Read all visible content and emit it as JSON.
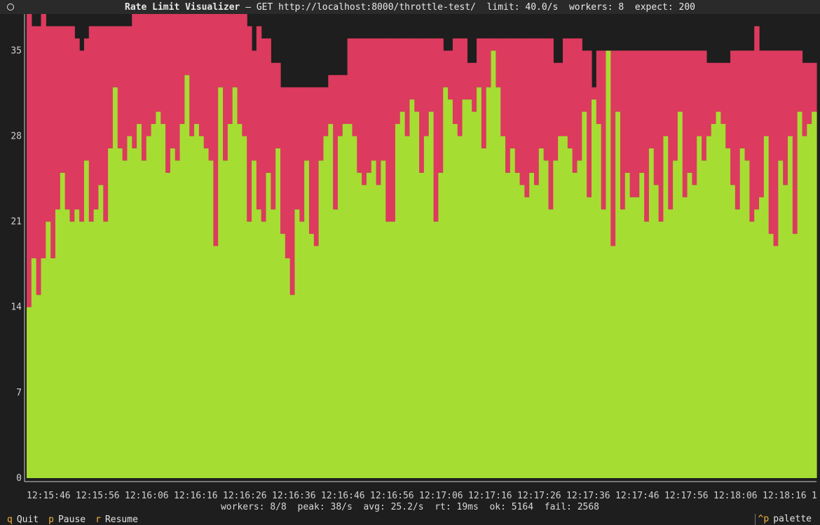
{
  "window": {
    "title": "Rate Limit Visualizer",
    "subtitle": " — GET http://localhost:8000/throttle-test/  limit: 40.0/s  workers: 8  expect: 200"
  },
  "footer": {
    "stats": "workers: 8/8  peak: 38/s  avg: 25.2/s  rt: 19ms  ok: 5164  fail: 2568"
  },
  "keys": [
    {
      "key": "q",
      "label": "Quit"
    },
    {
      "key": "p",
      "label": "Pause"
    },
    {
      "key": "r",
      "label": "Resume"
    }
  ],
  "palette": {
    "key": "^p",
    "label": "palette"
  },
  "colors": {
    "ok": "#a6dd33",
    "fail": "#dc3a5e",
    "empty": "#1e1e1e",
    "axis": "#cccccc"
  },
  "chart_data": {
    "type": "bar",
    "stacked": true,
    "ylim": [
      0,
      38
    ],
    "y_ticks": [
      0,
      7,
      14,
      21,
      28,
      35
    ],
    "x_tick_labels": [
      "12:15:46",
      "12:15:56",
      "12:16:06",
      "12:16:16",
      "12:16:26",
      "12:16:36",
      "12:16:46",
      "12:16:56",
      "12:17:06",
      "12:17:16",
      "12:17:26",
      "12:17:36",
      "12:17:46",
      "12:17:56",
      "12:18:06",
      "12:18:16",
      "1"
    ],
    "series": [
      {
        "values": [
          14,
          18,
          15,
          18,
          21,
          18,
          22,
          25,
          22,
          21,
          22,
          21,
          26,
          21,
          22,
          24,
          21,
          27,
          32,
          27,
          26,
          28,
          27,
          29,
          26,
          28,
          29,
          30,
          29,
          25,
          27,
          26,
          29,
          33,
          28,
          29,
          28,
          27,
          26,
          19,
          32,
          26,
          29,
          32,
          29,
          28,
          21,
          26,
          22,
          21,
          25,
          22,
          27,
          20,
          18,
          15,
          22,
          21,
          26,
          20,
          19,
          26,
          28,
          29,
          22,
          28,
          29,
          29,
          28,
          25,
          24,
          25,
          26,
          24,
          26,
          21,
          21,
          29,
          30,
          28,
          31,
          30,
          25,
          28,
          30,
          21,
          25,
          32,
          31,
          29,
          28,
          31,
          31,
          30,
          32,
          27,
          32,
          35,
          32,
          28,
          25,
          27,
          25,
          24,
          23,
          25,
          24,
          27,
          26,
          22,
          26,
          28,
          28,
          27,
          25,
          26,
          30,
          23,
          31,
          29,
          22,
          35,
          19,
          30,
          22,
          25,
          23,
          23,
          25,
          21,
          27,
          24,
          21,
          28,
          22,
          26,
          30,
          23,
          25,
          24,
          28,
          26,
          28,
          29,
          30,
          29,
          27,
          24,
          22,
          27,
          26,
          21,
          22,
          23,
          28,
          20,
          19,
          26,
          24,
          28,
          20,
          30,
          28,
          29,
          30
        ],
        "color": "#a6dd33"
      },
      {
        "values": [
          24,
          19,
          22,
          20,
          16,
          19,
          15,
          12,
          15,
          16,
          14,
          14,
          10,
          16,
          15,
          13,
          16,
          10,
          5,
          10,
          11,
          9,
          11,
          9,
          12,
          10,
          9,
          8,
          9,
          13,
          11,
          12,
          9,
          5,
          10,
          9,
          10,
          11,
          12,
          19,
          6,
          12,
          9,
          6,
          9,
          10,
          16,
          9,
          15,
          15,
          11,
          12,
          7,
          12,
          14,
          17,
          10,
          11,
          6,
          12,
          13,
          6,
          4,
          4,
          11,
          5,
          4,
          7,
          8,
          11,
          12,
          11,
          10,
          12,
          10,
          15,
          15,
          7,
          6,
          8,
          5,
          6,
          11,
          8,
          6,
          15,
          11,
          3,
          4,
          7,
          8,
          5,
          3,
          4,
          4,
          9,
          4,
          1,
          4,
          8,
          11,
          9,
          11,
          12,
          13,
          11,
          12,
          9,
          10,
          14,
          8,
          6,
          8,
          9,
          11,
          10,
          5,
          12,
          1,
          6,
          13,
          0,
          16,
          5,
          13,
          10,
          12,
          12,
          10,
          14,
          8,
          11,
          14,
          7,
          13,
          9,
          5,
          12,
          10,
          11,
          7,
          9,
          6,
          5,
          4,
          5,
          7,
          11,
          13,
          8,
          9,
          14,
          15,
          12,
          7,
          15,
          16,
          9,
          11,
          7,
          15,
          5,
          6,
          5,
          4
        ],
        "color": "#dc3a5e"
      }
    ]
  }
}
